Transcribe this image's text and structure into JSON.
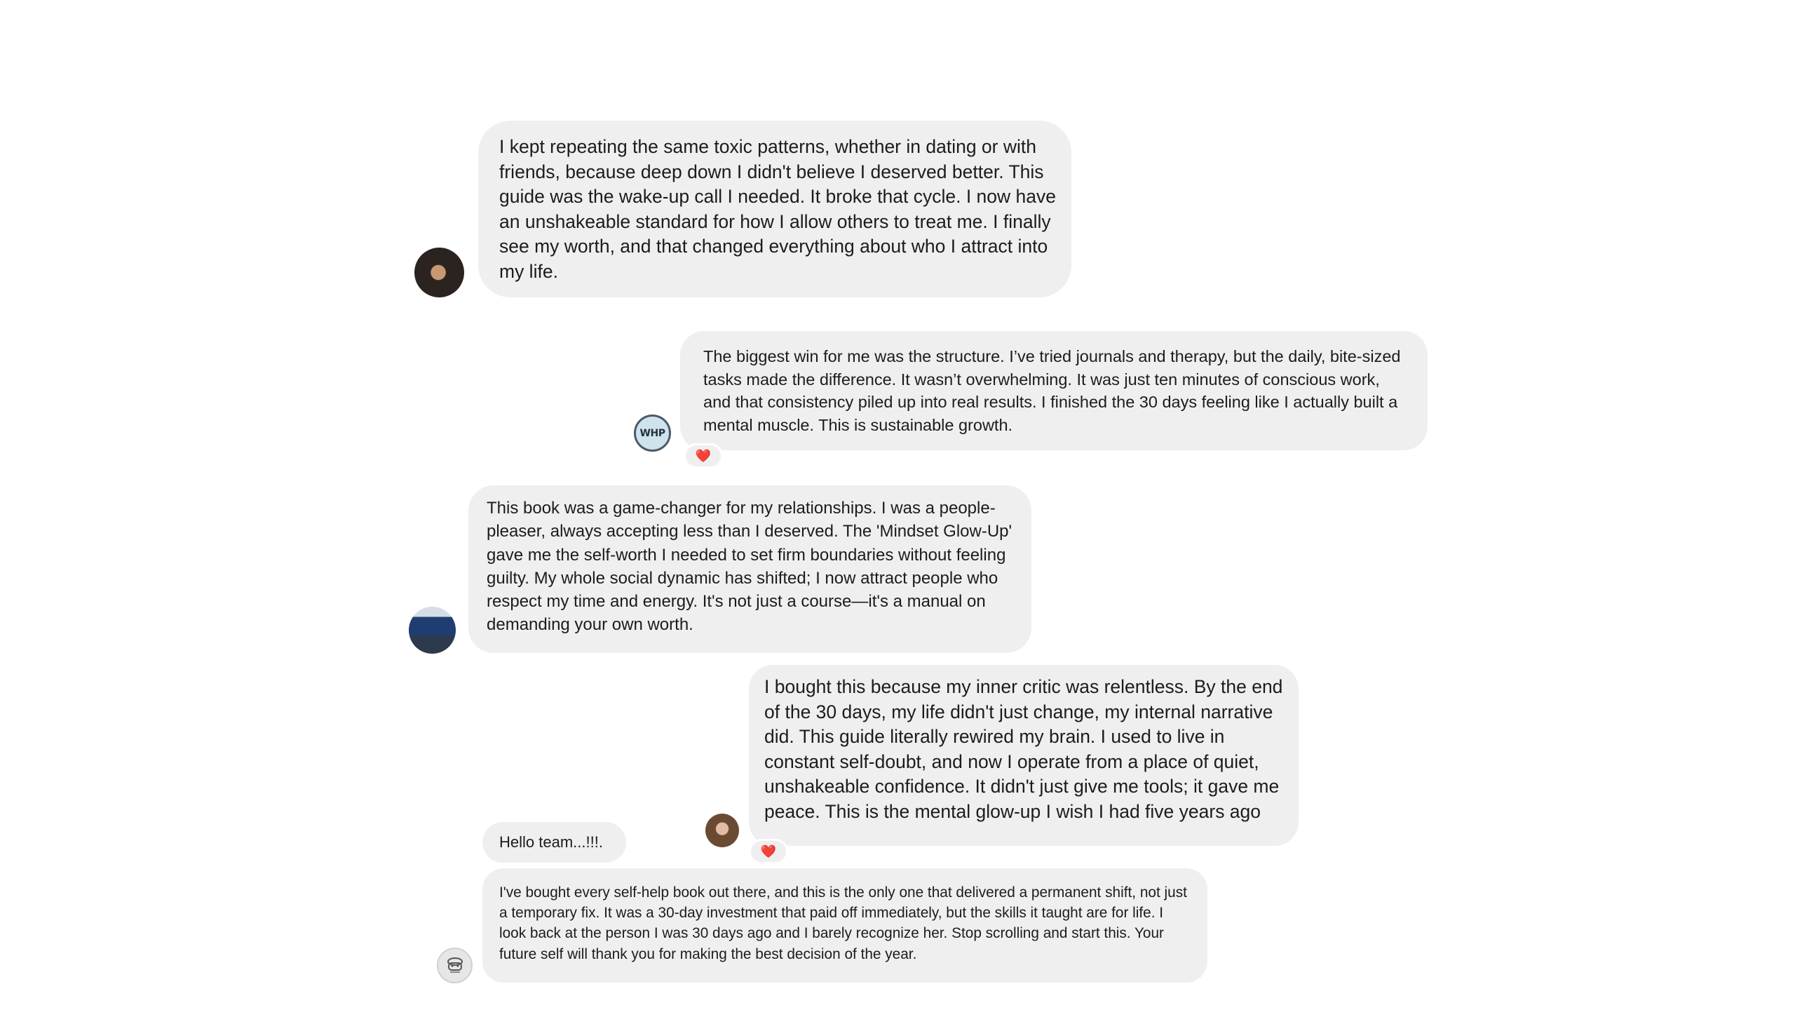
{
  "messages": [
    {
      "id": "m1",
      "text": "I kept repeating the same toxic patterns, whether in dating or with friends, because deep down I didn't believe I deserved better. This guide was the wake-up call I needed. It broke that cycle. I now have an unshakeable standard for how I allow others to treat me. I finally see my worth, and that changed everything about who I attract into my life.",
      "reaction": ""
    },
    {
      "id": "m2",
      "text": "The biggest win for me was the structure. I’ve tried journals and therapy, but the daily, bite-sized tasks made the difference. It wasn’t overwhelming. It was just ten minutes of conscious work, and that consistency piled up into real results. I finished the 30 days feeling like I actually built a mental muscle. This is sustainable growth.",
      "reaction": "❤️",
      "avatar_text": "WHP"
    },
    {
      "id": "m3",
      "text": "This book was a game-changer for my relationships. I was a people-pleaser, always accepting less than I deserved. The 'Mindset Glow-Up' gave me the self-worth I needed to set firm boundaries without feeling guilty. My whole social dynamic has shifted; I now attract people who respect my time and energy. It's not just a course—it's a manual on demanding your own worth.",
      "reaction": ""
    },
    {
      "id": "m4",
      "text": "I bought this because my inner critic was relentless. By the end of the 30 days, my life didn't just change, my internal narrative did. This guide literally rewired my brain. I used to live in constant self-doubt, and now I operate from a place of quiet, unshakeable confidence. It didn't just give me tools; it gave me peace. This is the mental glow-up I wish I had five years ago",
      "reaction": "❤️"
    },
    {
      "id": "m5",
      "text": "Hello team...!!!.",
      "reaction": ""
    },
    {
      "id": "m6",
      "text": "I've bought every self-help book out there, and this is the only one that delivered a permanent shift, not just a temporary fix. It was a 30-day investment that paid off immediately, but the skills it taught are for life. I look back at the person I was 30 days ago and I barely recognize her. Stop scrolling and start this. Your future self will thank you for making the best decision of the year.",
      "reaction": ""
    }
  ],
  "colors": {
    "bubble": "#efefef",
    "background": "#ffffff",
    "text": "#1c1c1e",
    "heart": "#e0245e"
  },
  "icons": {
    "reaction": "heart-icon",
    "avatar_6": "cartoon-character-icon"
  }
}
